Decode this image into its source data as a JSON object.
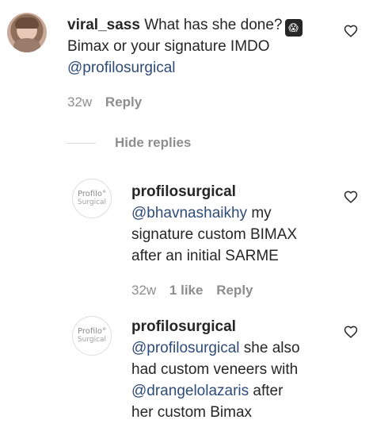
{
  "comments": [
    {
      "username": "viral_sass",
      "text_line1": "What has she done?",
      "emoji": "😱",
      "text_line2": "Bimax or your signature IMDO",
      "mention": "@profilosurgical",
      "time": "32w",
      "reply": "Reply"
    }
  ],
  "hide_replies": "Hide replies",
  "replies": [
    {
      "avatar_top": "Profilo°",
      "avatar_bottom": "Surgical",
      "username": "profilosurgical",
      "line1_mention": "@bhavnashaikhy",
      "line1_rest": " my",
      "line2": "signature custom BIMAX",
      "line3": "after an initial SARME",
      "time": "32w",
      "likes": "1 like",
      "reply": "Reply"
    },
    {
      "avatar_top": "Profilo°",
      "avatar_bottom": "Surgical",
      "username": "profilosurgical",
      "line1_mention": "@profilosurgical",
      "line1_rest": " she also",
      "line2": "had custom veneers with",
      "line3_mention": "@drangelolazaris",
      "line3_rest": " after",
      "line4": "her custom Bimax"
    }
  ],
  "colors": {
    "mention": "#2e4b7a",
    "meta": "#8e8e8e",
    "text": "#262626"
  },
  "icons": {
    "like": "heart-outline-icon"
  }
}
